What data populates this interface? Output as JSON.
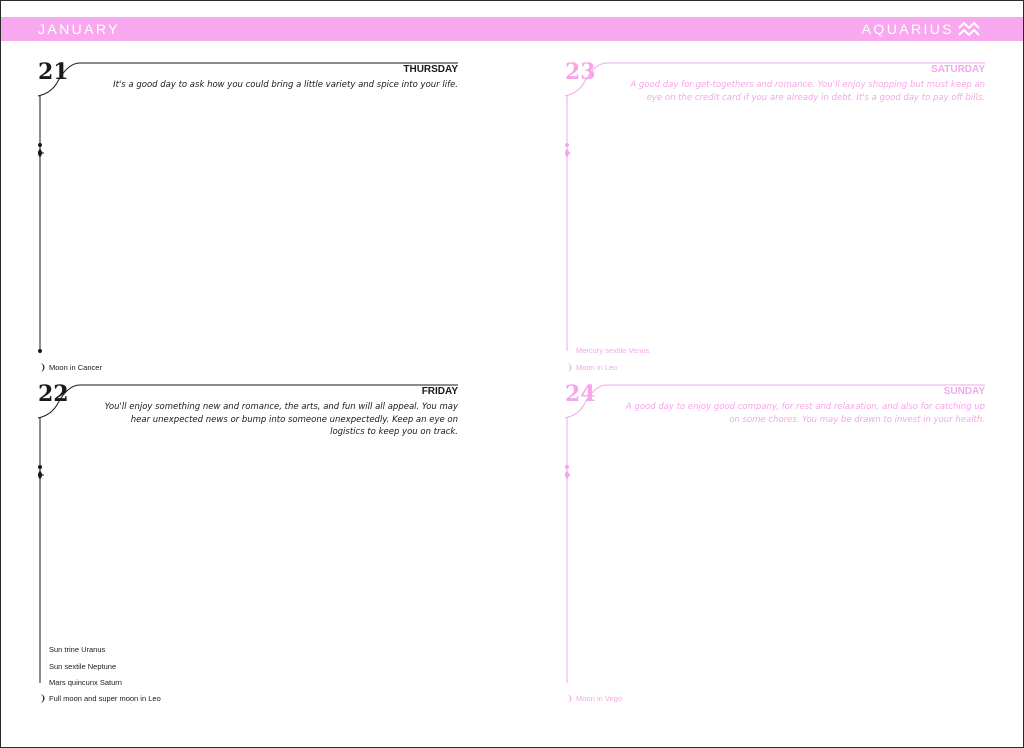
{
  "header": {
    "month": "JANUARY",
    "sign": "AQUARIUS",
    "sign_icon": "aquarius-glyph-icon",
    "band_color": "#f7a8ee"
  },
  "days": [
    {
      "number": "21",
      "weekday": "THURSDAY",
      "forecast": "It's a good day to ask how you could bring a little variety and spice into your life.",
      "aspects": [],
      "moon": "Moon in Cancer"
    },
    {
      "number": "22",
      "weekday": "FRIDAY",
      "forecast": "You'll enjoy something new and romance, the arts, and fun will all appeal. You may hear unexpected news or bump into someone unexpectedly. Keep an eye on logistics to keep you on track.",
      "aspects": [
        "Sun trine Uranus",
        "Sun sextile Neptune",
        "Mars quincunx Saturn"
      ],
      "moon": "Full moon and super moon in Leo"
    },
    {
      "number": "23",
      "weekday": "SATURDAY",
      "forecast": "A good day for get-togethers and romance. You'll enjoy shopping but must keep an eye on the credit card if you are already in debt. It's a good day to pay off bills.",
      "aspects": [
        "Mercury sextile Venus"
      ],
      "moon": "Moon in Leo"
    },
    {
      "number": "24",
      "weekday": "SUNDAY",
      "forecast": "A good day to enjoy good company, for rest and relaxation, and also for catching up on some chores. You may be drawn to invest in your health.",
      "aspects": [],
      "moon": "Moon in Virgo"
    }
  ],
  "colors": {
    "dark": "#1a1a1a",
    "pink": "#f4a6ea"
  }
}
